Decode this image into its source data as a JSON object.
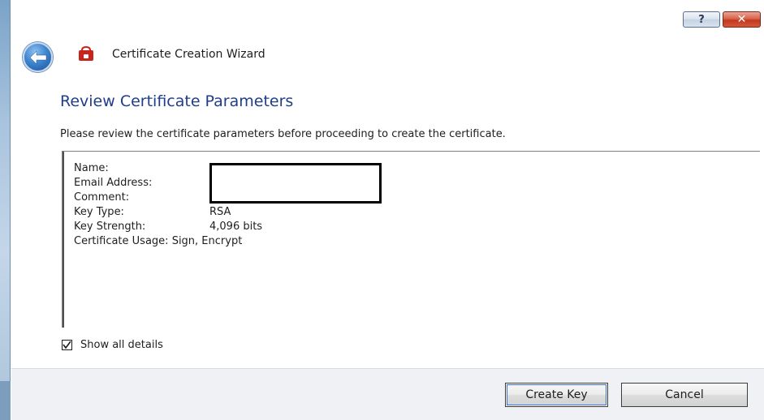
{
  "window": {
    "caption_help_label": "?",
    "caption_close_label": "✕"
  },
  "header": {
    "title": "Certificate Creation Wizard",
    "back_icon": "back-arrow-icon",
    "app_icon": "certificate-wizard-icon"
  },
  "main": {
    "section_title": "Review Certificate Parameters",
    "instruction": "Please review the certificate parameters before proceeding to create the certificate.",
    "parameters": [
      {
        "label": "Name:",
        "value": ""
      },
      {
        "label": "Email Address:",
        "value": ""
      },
      {
        "label": "Comment:",
        "value": ""
      },
      {
        "label": "Key Type:",
        "value": "RSA"
      },
      {
        "label": "Key Strength:",
        "value": "4,096 bits"
      },
      {
        "label": "Certificate Usage:",
        "value": "Sign, Encrypt"
      }
    ],
    "show_details_label": "Show all details",
    "show_details_checked": true
  },
  "footer": {
    "create_label": "Create Key",
    "cancel_label": "Cancel"
  },
  "colors": {
    "section_title": "#1e3e8a",
    "footer_bg": "#eff1f4",
    "close_button": "#c23a20"
  }
}
